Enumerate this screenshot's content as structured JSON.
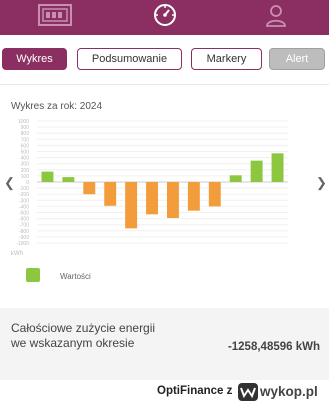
{
  "nav": {
    "icons": [
      "dashboard-display-icon",
      "speedometer-icon",
      "user-profile-icon"
    ]
  },
  "tabs": [
    {
      "label": "Wykres",
      "state": "active"
    },
    {
      "label": "Podsumowanie",
      "state": "normal"
    },
    {
      "label": "Markery",
      "state": "normal"
    },
    {
      "label": "Alert",
      "state": "disabled"
    }
  ],
  "chart_title": "Wykres za rok: 2024",
  "chart_data": {
    "type": "bar",
    "ylabel": "kWh",
    "ylim": [
      -1000,
      1000
    ],
    "y_ticks": [
      "1000",
      "900",
      "800",
      "700",
      "600",
      "500",
      "400",
      "300",
      "200",
      "100",
      "0",
      "-100",
      "-200",
      "-300",
      "-400",
      "-500",
      "-600",
      "-700",
      "-800",
      "-900",
      "-1000"
    ],
    "values": [
      170,
      80,
      -200,
      -390,
      -760,
      -530,
      -590,
      -470,
      -400,
      110,
      350,
      470
    ],
    "legend": [
      {
        "name": "Wartości",
        "color": "#8dc63f"
      }
    ],
    "positive_color": "#8dc63f",
    "negative_color": "#f39c3c"
  },
  "summary": {
    "label": "Całościowe zużycie energii we wskazanym okresie",
    "value": "-1258,48596 kWh"
  },
  "footer": {
    "text": "OptiFinance  z",
    "watermark": "wykop.pl"
  },
  "colors": {
    "brand": "#8b2f62",
    "positive": "#8dc63f",
    "negative": "#f39c3c"
  }
}
